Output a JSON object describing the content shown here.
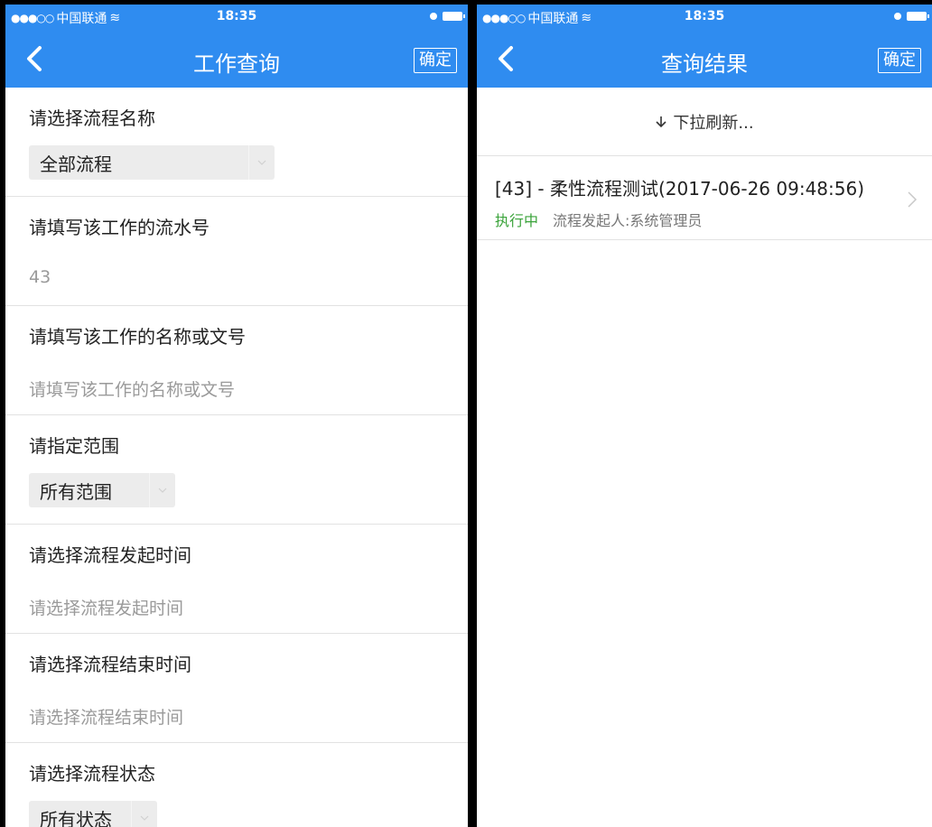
{
  "left": {
    "status": {
      "carrier": "中国联通",
      "time": "18:35"
    },
    "nav": {
      "title": "工作查询",
      "confirm_label": "确定"
    },
    "sections": [
      {
        "label": "请选择流程名称",
        "select": "全部流程"
      },
      {
        "label": "请填写该工作的流水号",
        "value": "43"
      },
      {
        "label": "请填写该工作的名称或文号",
        "placeholder": "请填写该工作的名称或文号"
      },
      {
        "label": "请指定范围",
        "select": "所有范围"
      },
      {
        "label": "请选择流程发起时间",
        "placeholder": "请选择流程发起时间"
      },
      {
        "label": "请选择流程结束时间",
        "placeholder": "请选择流程结束时间"
      },
      {
        "label": "请选择流程状态",
        "select": "所有状态"
      }
    ]
  },
  "right": {
    "status": {
      "carrier": "中国联通",
      "time": "18:35"
    },
    "nav": {
      "title": "查询结果",
      "confirm_label": "确定"
    },
    "refresh_label": "下拉刷新...",
    "results": [
      {
        "title": "[43] - 柔性流程测试(2017-06-26 09:48:56)",
        "status": "执行中",
        "initiator": "流程发起人:系统管理员"
      }
    ]
  },
  "colors": {
    "brand": "#2f8cf0",
    "status_running": "#3aa33a"
  }
}
